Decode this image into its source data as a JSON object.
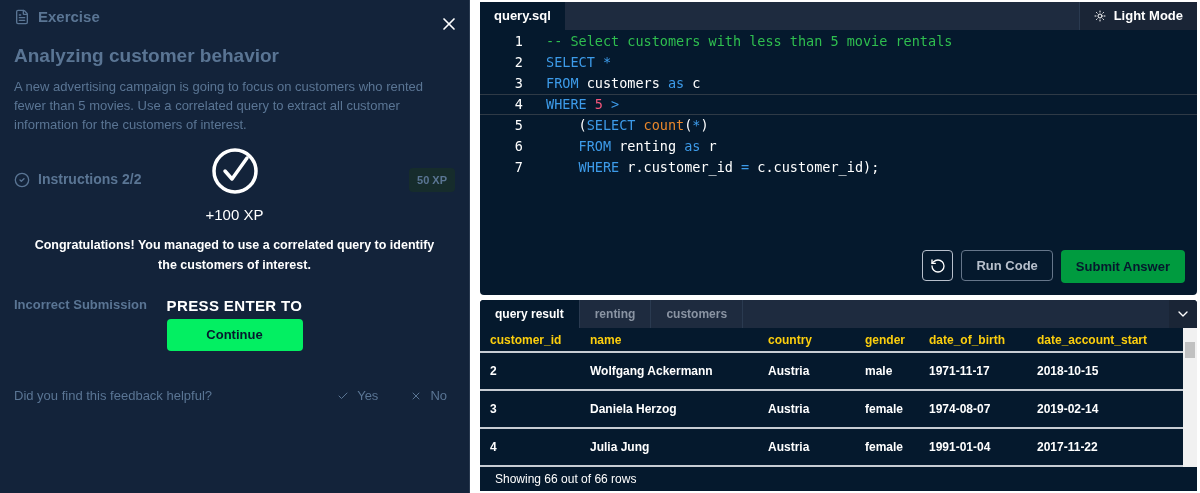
{
  "exercise": {
    "header": "Exercise",
    "title": "Analyzing customer behavior",
    "description": "A new advertising campaign is going to focus on customers who rented fewer than 5 movies. Use a correlated query to extract all customer information for the customers of interest.",
    "instructions_title": "Instructions 2/2",
    "xp_badge": "50 XP",
    "feedback_title": "Incorrect Submission",
    "helpful_question": "Did you find this feedback helpful?",
    "yes": "Yes",
    "no": "No"
  },
  "modal": {
    "xp": "+100 XP",
    "message": "Congratulations! You managed to use a correlated query to identify the customers of interest.",
    "press_enter": "PRESS ENTER TO",
    "continue": "Continue"
  },
  "editor": {
    "tab": "query.sql",
    "theme_button": "Light Mode",
    "lines": [
      {
        "number": "1",
        "current": false,
        "tokens": [
          {
            "kind": "comment",
            "text": "-- Select customers with less than 5 movie rentals"
          }
        ]
      },
      {
        "number": "2",
        "current": false,
        "tokens": [
          {
            "kind": "keyword",
            "text": "SELECT "
          },
          {
            "kind": "keyword",
            "text": "*"
          }
        ]
      },
      {
        "number": "3",
        "current": false,
        "tokens": [
          {
            "kind": "keyword",
            "text": "FROM "
          },
          {
            "kind": "plain",
            "text": "customers "
          },
          {
            "kind": "keyword",
            "text": "as "
          },
          {
            "kind": "plain",
            "text": "c"
          }
        ]
      },
      {
        "number": "4",
        "current": true,
        "tokens": [
          {
            "kind": "keyword",
            "text": "WHERE "
          },
          {
            "kind": "number",
            "text": "5 "
          },
          {
            "kind": "keyword",
            "text": ">"
          }
        ]
      },
      {
        "number": "5",
        "current": false,
        "tokens": [
          {
            "kind": "plain",
            "text": "    ("
          },
          {
            "kind": "keyword",
            "text": "SELECT "
          },
          {
            "kind": "function",
            "text": "count"
          },
          {
            "kind": "plain",
            "text": "("
          },
          {
            "kind": "keyword",
            "text": "*"
          },
          {
            "kind": "plain",
            "text": ")"
          }
        ]
      },
      {
        "number": "6",
        "current": false,
        "tokens": [
          {
            "kind": "keyword",
            "text": "    FROM "
          },
          {
            "kind": "plain",
            "text": "renting "
          },
          {
            "kind": "keyword",
            "text": "as "
          },
          {
            "kind": "plain",
            "text": "r"
          }
        ]
      },
      {
        "number": "7",
        "current": false,
        "tokens": [
          {
            "kind": "keyword",
            "text": "    WHERE "
          },
          {
            "kind": "plain",
            "text": "r.customer_id "
          },
          {
            "kind": "keyword",
            "text": "= "
          },
          {
            "kind": "plain",
            "text": "c.customer_id);"
          }
        ]
      }
    ],
    "run_button": "Run Code",
    "submit_button": "Submit Answer"
  },
  "results": {
    "tabs": [
      {
        "label": "query result",
        "selected": true
      },
      {
        "label": "renting",
        "selected": false
      },
      {
        "label": "customers",
        "selected": false
      }
    ],
    "columns": [
      "customer_id",
      "name",
      "country",
      "gender",
      "date_of_birth",
      "date_account_start"
    ],
    "rows": [
      [
        "2",
        "Wolfgang Ackermann",
        "Austria",
        "male",
        "1971-11-17",
        "2018-10-15"
      ],
      [
        "3",
        "Daniela Herzog",
        "Austria",
        "female",
        "1974-08-07",
        "2019-02-14"
      ],
      [
        "4",
        "Julia Jung",
        "Austria",
        "female",
        "1991-01-04",
        "2017-11-22"
      ]
    ],
    "status": "Showing 66 out of 66 rows"
  }
}
